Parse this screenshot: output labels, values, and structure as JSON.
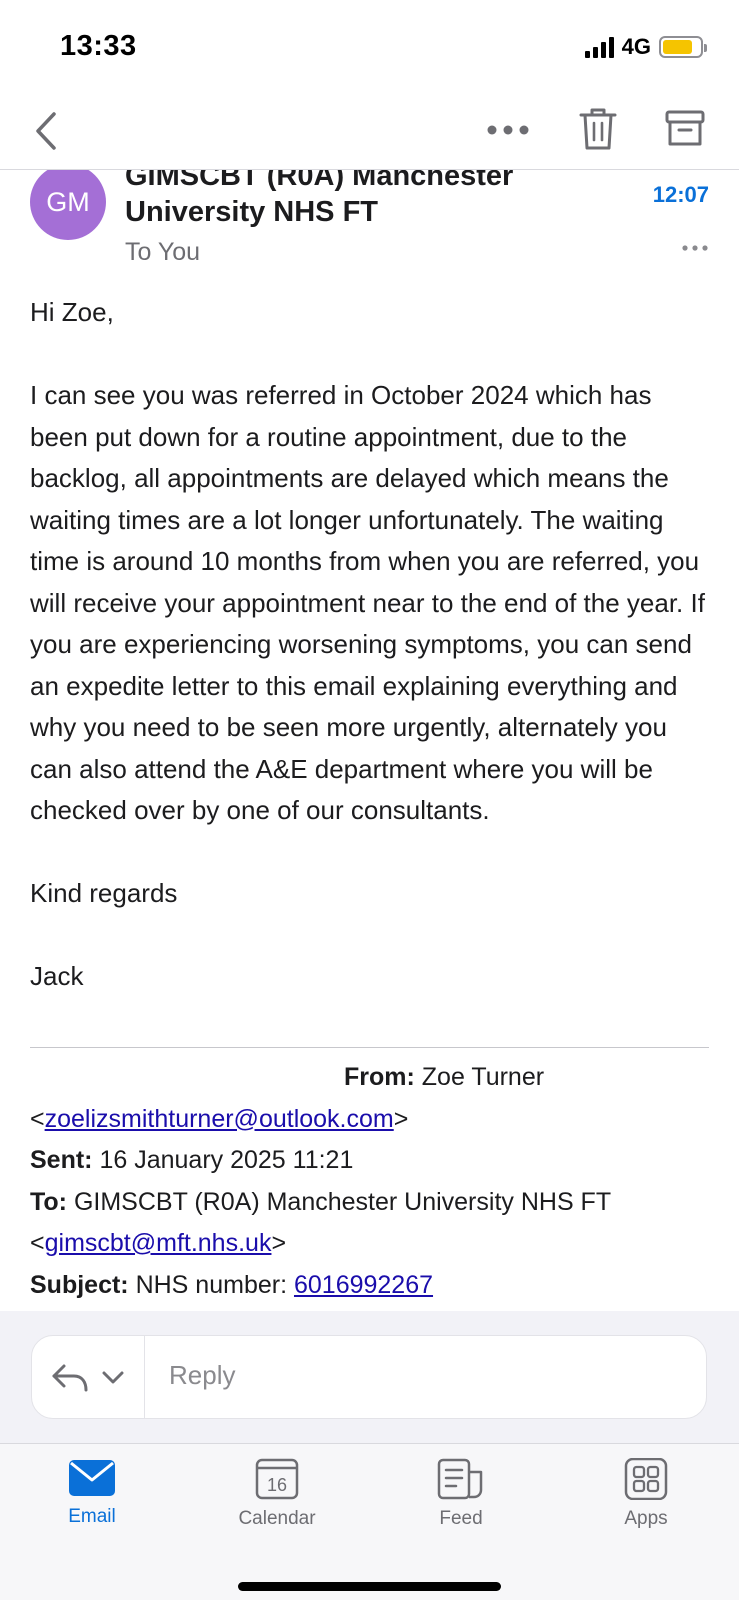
{
  "status_bar": {
    "time": "13:33",
    "network": "4G",
    "battery_fraction": 0.8
  },
  "nav": {
    "back_icon": "chevron-left-icon",
    "more_icon": "ellipsis-icon",
    "trash_icon": "trash-icon",
    "archive_icon": "archive-icon"
  },
  "header": {
    "avatar_initials": "GM",
    "avatar_color": "#a46fd6",
    "sender": "GIMSCBT (R0A) Manchester University NHS FT",
    "recipient": "To You",
    "time": "12:07"
  },
  "body": {
    "greeting": "Hi Zoe,",
    "paragraph": "I can see you was referred in October 2024 which has been put down for a routine appointment, due to the backlog, all appointments are delayed which means the waiting times are a lot longer unfortunately. The waiting time is around 10 months from when you are referred, you will receive your appointment near to the end of the year. If you are experiencing worsening symptoms, you can send an expedite letter to this email explaining everything and why you need to be seen more urgently, alternately you can also attend the A&E department where you will be checked over by one of our consultants.",
    "signoff": "Kind regards",
    "signature": "Jack"
  },
  "quoted": {
    "from_label": "From:",
    "from_name": "Zoe Turner",
    "from_email": "zoelizsmithturner@outlook.com",
    "sent_label": "Sent:",
    "sent_value": "16 January 2025 11:21",
    "to_label": "To:",
    "to_name": "GIMSCBT (R0A) Manchester University NHS FT",
    "to_email": "gimscbt@mft.nhs.uk",
    "subject_label": "Subject:",
    "subject_text": "NHS number:",
    "subject_number": "6016992267"
  },
  "reply": {
    "placeholder": "Reply"
  },
  "tabs": [
    {
      "label": "Email",
      "icon": "mail-icon",
      "active": true
    },
    {
      "label": "Calendar",
      "icon": "calendar-icon",
      "badge": "16"
    },
    {
      "label": "Feed",
      "icon": "feed-icon"
    },
    {
      "label": "Apps",
      "icon": "apps-icon"
    }
  ],
  "colors": {
    "accent": "#0a70d8",
    "avatar": "#a46fd6",
    "link": "#1a0dab"
  }
}
